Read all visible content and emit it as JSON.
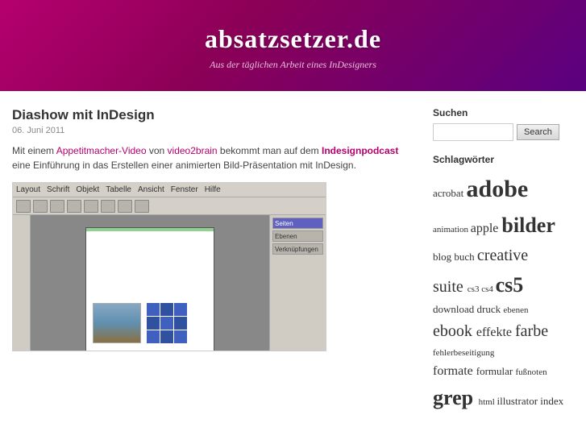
{
  "header": {
    "site_title": "absatzsetzer.de",
    "tagline": "Aus der täglichen Arbeit eines InDesigners"
  },
  "post": {
    "title": "Diashow mit InDesign",
    "date": "06. Juni 2011",
    "content_part1": "Mit einem ",
    "link1_text": "Appetitmacher-Video",
    "link1_href": "#",
    "content_part2": " von ",
    "link2_text": "video2brain",
    "link2_href": "#",
    "content_part3": " bekommt man auf dem ",
    "link3_text": "Indesignpodcast",
    "link3_href": "#",
    "content_part4": " eine Einführung in das Erstellen einer animierten Bild-Präsentation mit InDesign."
  },
  "indesign_mockup": {
    "menu_items": [
      "Layout",
      "Schrift",
      "Objekt",
      "Tabelle",
      "Ansicht",
      "Fenster",
      "Hilfe"
    ]
  },
  "sidebar": {
    "search_label": "Suchen",
    "search_placeholder": "",
    "search_button": "Search",
    "tags_label": "Schlagwörter",
    "tags": [
      {
        "text": "acrobat",
        "size": "sm"
      },
      {
        "text": "adobe",
        "size": "xxl"
      },
      {
        "text": "animation",
        "size": "xs"
      },
      {
        "text": "apple",
        "size": "md"
      },
      {
        "text": "bilder",
        "size": "xl"
      },
      {
        "text": "blog",
        "size": "sm"
      },
      {
        "text": "buch",
        "size": "sm"
      },
      {
        "text": "creative",
        "size": "lg"
      },
      {
        "text": "suite",
        "size": "lg"
      },
      {
        "text": "cs3",
        "size": "xs"
      },
      {
        "text": "cs4",
        "size": "xs"
      },
      {
        "text": "cs5",
        "size": "xl"
      },
      {
        "text": "download",
        "size": "sm"
      },
      {
        "text": "druck",
        "size": "sm"
      },
      {
        "text": "ebenen",
        "size": "xs"
      },
      {
        "text": "ebook",
        "size": "lg"
      },
      {
        "text": "effekte",
        "size": "md"
      },
      {
        "text": "farbe",
        "size": "lg"
      },
      {
        "text": "fehlerbeseitigung",
        "size": "xs"
      },
      {
        "text": "formate",
        "size": "md"
      },
      {
        "text": "formular",
        "size": "sm"
      },
      {
        "text": "fußnoten",
        "size": "xs"
      },
      {
        "text": "grep",
        "size": "xl"
      },
      {
        "text": "html",
        "size": "xs"
      },
      {
        "text": "illustrator",
        "size": "sm"
      },
      {
        "text": "index",
        "size": "sm"
      }
    ]
  }
}
